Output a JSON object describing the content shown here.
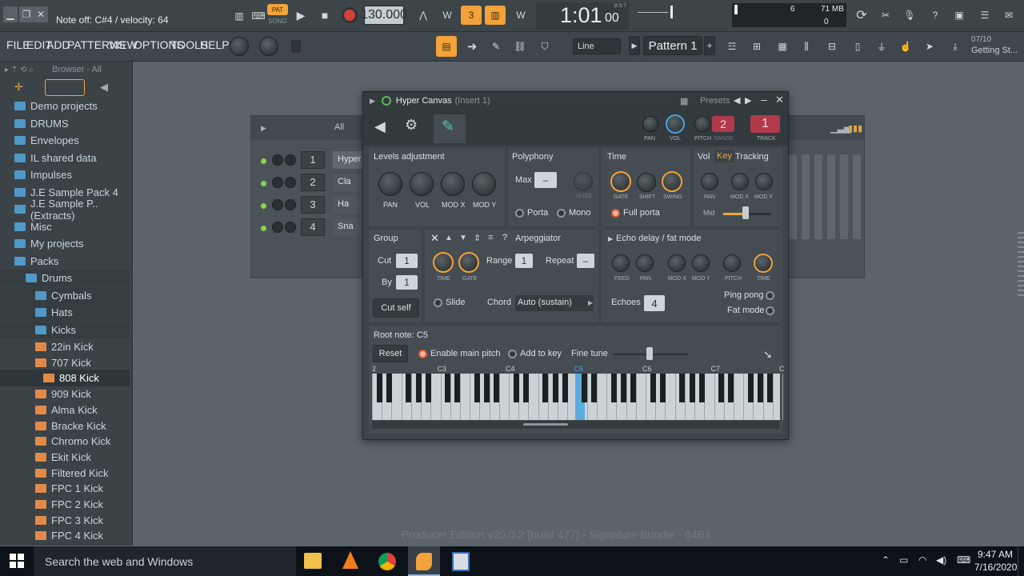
{
  "topbar": {
    "hint": "Note off: C#4 / velocity: 64",
    "pat_label": "PAT",
    "song_label": "SONG",
    "tempo": "130.000",
    "time": "1:01",
    "time_sub": "00",
    "bst": "B:S:T",
    "cpu_num": "6",
    "mem": "71 MB",
    "mem_sub": "0"
  },
  "menu": {
    "items": [
      "FILE",
      "EDIT",
      "ADD",
      "PATTERNS",
      "VIEW",
      "OPTIONS",
      "TOOLS",
      "HELP"
    ],
    "snap": "Line",
    "pattern": "Pattern 1",
    "news_date": "07/10",
    "news_text": "Getting St..."
  },
  "browser": {
    "title": "Browser - All",
    "items": [
      {
        "label": "Demo projects",
        "type": "folder",
        "indent": 0
      },
      {
        "label": "DRUMS",
        "type": "folder",
        "indent": 0
      },
      {
        "label": "Envelopes",
        "type": "folder",
        "indent": 0
      },
      {
        "label": "IL shared data",
        "type": "folder",
        "indent": 0
      },
      {
        "label": "Impulses",
        "type": "folder",
        "indent": 0
      },
      {
        "label": "J.E Sample Pack 4",
        "type": "folder",
        "indent": 0
      },
      {
        "label": "J.E Sample P..(Extracts)",
        "type": "folder",
        "indent": 0
      },
      {
        "label": "Misc",
        "type": "folder",
        "indent": 0
      },
      {
        "label": "My projects",
        "type": "folder",
        "indent": 0
      },
      {
        "label": "Packs",
        "type": "open-folder",
        "indent": 0
      },
      {
        "label": "Drums",
        "type": "open-folder",
        "indent": 1
      },
      {
        "label": "Cymbals",
        "type": "folder",
        "indent": 2
      },
      {
        "label": "Hats",
        "type": "folder",
        "indent": 2
      },
      {
        "label": "Kicks",
        "type": "open-folder",
        "indent": 2
      },
      {
        "label": "22in Kick",
        "type": "file",
        "indent": 2
      },
      {
        "label": "707 Kick",
        "type": "file",
        "indent": 2
      },
      {
        "label": "808 Kick",
        "type": "file",
        "indent": 3
      },
      {
        "label": "909 Kick",
        "type": "file",
        "indent": 2
      },
      {
        "label": "Alma Kick",
        "type": "file",
        "indent": 2
      },
      {
        "label": "Bracke Kick",
        "type": "file",
        "indent": 2
      },
      {
        "label": "Chromo Kick",
        "type": "file",
        "indent": 2
      },
      {
        "label": "Ekit Kick",
        "type": "file",
        "indent": 2
      },
      {
        "label": "Filtered Kick",
        "type": "file",
        "indent": 2
      },
      {
        "label": "FPC 1 Kick",
        "type": "file",
        "indent": 2
      },
      {
        "label": "FPC 2 Kick",
        "type": "file",
        "indent": 2
      },
      {
        "label": "FPC 3 Kick",
        "type": "file",
        "indent": 2
      },
      {
        "label": "FPC 4 Kick",
        "type": "file",
        "indent": 2
      }
    ]
  },
  "channel_rack": {
    "filter": "All",
    "rows": [
      {
        "num": "1",
        "name": "Hyper"
      },
      {
        "num": "2",
        "name": "Cla"
      },
      {
        "num": "3",
        "name": "Ha"
      },
      {
        "num": "4",
        "name": "Sna"
      }
    ]
  },
  "plugin": {
    "title": "Hyper Canvas",
    "insert": "(Insert 1)",
    "presets": "Presets",
    "header_knobs": [
      "PAN",
      "VOL",
      "PITCH",
      "RANGE",
      "TRACK"
    ],
    "range_value": "2",
    "track_value": "1",
    "levels": {
      "title": "Levels adjustment",
      "knobs": [
        "PAN",
        "VOL",
        "MOD X",
        "MOD Y"
      ]
    },
    "polyphony": {
      "title": "Polyphony",
      "max": "Max",
      "slide": "SLIDE",
      "porta": "Porta",
      "mono": "Mono"
    },
    "time": {
      "title": "Time",
      "knobs": [
        "GATE",
        "SHIFT",
        "SWING"
      ],
      "full_porta": "Full porta"
    },
    "vkt": {
      "vol": "Vol",
      "key": "Key",
      "tracking": "Tracking",
      "knobs": [
        "PAN",
        "MOD X",
        "MOD Y"
      ],
      "mid": "Mid"
    },
    "group": {
      "title": "Group",
      "cut": "Cut",
      "cut_val": "1",
      "by": "By",
      "by_val": "1",
      "cut_self": "Cut self"
    },
    "arp": {
      "title": "Arpeggiator",
      "knobs": [
        "TIME",
        "GATE"
      ],
      "range": "Range",
      "range_val": "1",
      "repeat": "Repeat",
      "slide": "Slide",
      "chord": "Chord",
      "chord_val": "Auto (sustain)"
    },
    "echo": {
      "title": "Echo delay / fat mode",
      "knobs": [
        "FEED",
        "PAN",
        "MOD X",
        "MOD Y",
        "PITCH",
        "TIME"
      ],
      "echoes": "Echoes",
      "echoes_val": "4",
      "ping_pong": "Ping pong",
      "fat_mode": "Fat mode"
    },
    "root": {
      "title": "Root note: C5",
      "reset": "Reset",
      "enable_main_pitch": "Enable main pitch",
      "add_to_key": "Add to key",
      "fine_tune": "Fine tune"
    },
    "octaves": [
      "2",
      "C3",
      "C4",
      "C5",
      "C6",
      "C7",
      "C"
    ]
  },
  "status": {
    "text": "Producer Edition v20.0.2 [build 477] - Signature Bundle - 64Bit"
  },
  "taskbar": {
    "search": "Search the web and Windows",
    "time": "9:47 AM",
    "date": "7/16/2020"
  }
}
